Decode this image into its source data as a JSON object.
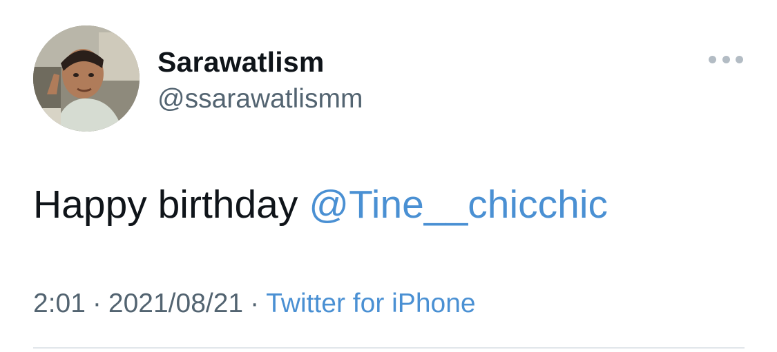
{
  "author": {
    "display_name": "Sarawatlism",
    "handle": "@ssarawatlismm",
    "avatar": "profile-photo"
  },
  "tweet": {
    "text": "Happy birthday ",
    "mention": "@Tine__chicchic"
  },
  "meta": {
    "time": "2:01",
    "separator": "·",
    "date": "2021/08/21",
    "source": "Twitter for iPhone"
  },
  "icons": {
    "more": "more-horizontal-icon"
  },
  "colors": {
    "text": "#0f1419",
    "secondary": "#536471",
    "link": "#4a90d3",
    "divider": "#e1e6ea"
  }
}
